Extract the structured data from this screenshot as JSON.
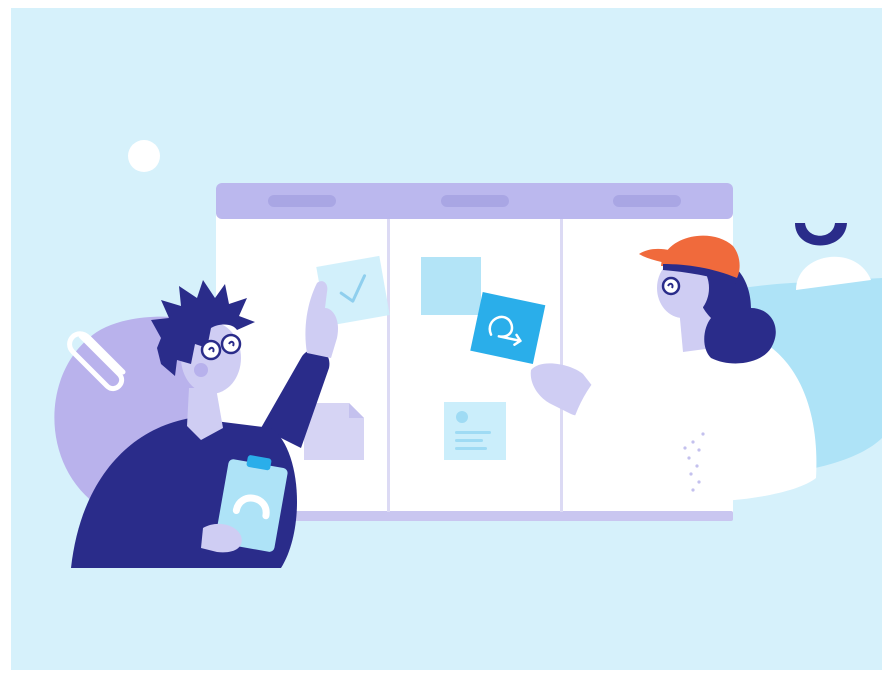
{
  "illustration": {
    "colors": {
      "background": "#d6f1fb",
      "board_header": "#bbb8ee",
      "board_header_pill": "#a9a6e4",
      "board_body": "#ffffff",
      "board_divider": "#dcdaf4",
      "card_light_blue": "#b3e4f7",
      "card_blue": "#2aaeea",
      "card_lavender": "#d6d4f4",
      "navy": "#2a2c8a",
      "lavender_blob": "#b9b2ec",
      "hat_orange": "#f06a3c",
      "skin": "#cfcdf3",
      "white": "#ffffff"
    },
    "icons": [
      "check-icon",
      "sprint-loop-icon",
      "paperclip-icon",
      "profile-card-icon",
      "clipboard-progress-icon"
    ]
  }
}
